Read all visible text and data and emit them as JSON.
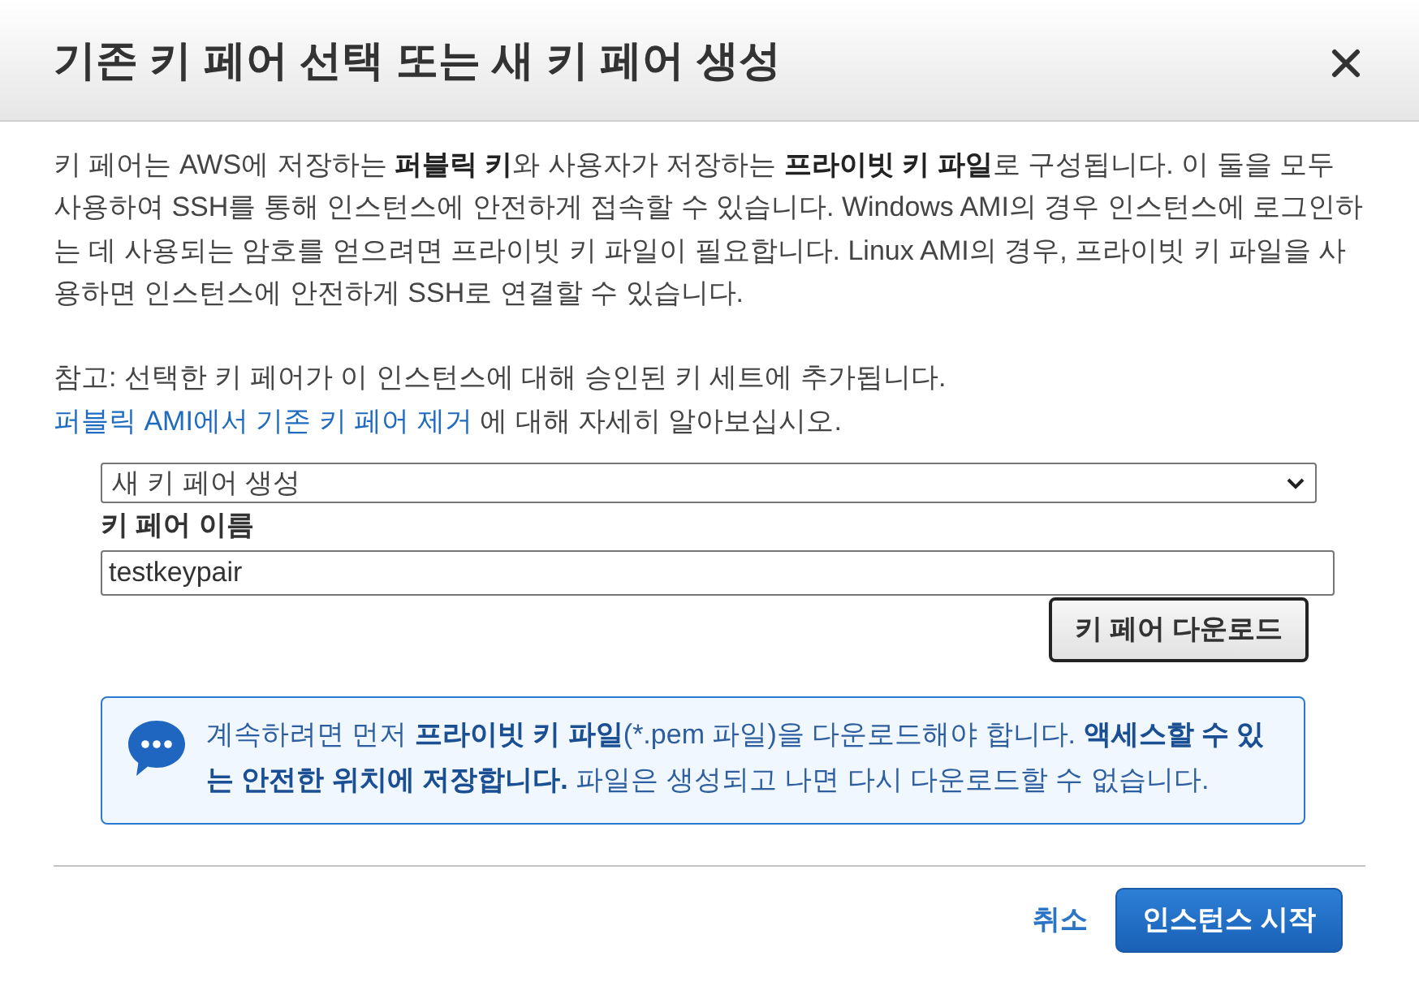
{
  "dialog": {
    "title": "기존 키 페어 선택 또는 새 키 페어 생성"
  },
  "description": "키 페어는 AWS에 저장하는 **퍼블릭 키**와 사용자가 저장하는 **프라이빗 키 파일**로 구성됩니다. 이 둘을 모두 사용하여 SSH를 통해 인스턴스에 안전하게 접속할 수 있습니다. Windows AMI의 경우 인스턴스에 로그인하는 데 사용되는 암호를 얻으려면 프라이빗 키 파일이 필요합니다. Linux AMI의 경우, 프라이빗 키 파일을 사용하면 인스턴스에 안전하게 SSH로 연결할 수 있습니다.",
  "note": {
    "text": "참고: 선택한 키 페어가 이 인스턴스에 대해 승인된 키 세트에 추가됩니다.",
    "link": "퍼블릭 AMI에서 기존 키 페어 제거",
    "suffix": "에 대해 자세히 알아보십시오."
  },
  "key_pair_select": {
    "value": "새 키 페어 생성"
  },
  "key_pair_name": {
    "label": "키 페어 이름",
    "value": "testkeypair"
  },
  "download_button": "키 페어 다운로드",
  "info": [
    {
      "text": "계속하려면 먼저 ",
      "bold": false
    },
    {
      "text": "프라이빗 키 파일",
      "bold": true
    },
    {
      "text": "(*.pem 파일)을 다운로드해야 합니다. ",
      "bold": false
    },
    {
      "text": "액세스할 수 있는 안전한 위치에 저장합니다.",
      "bold": true
    },
    {
      "text": " 파일은 생성되고 나면 다시 다운로드할 수 없습니다.",
      "bold": false
    }
  ],
  "footer": {
    "cancel": "취소",
    "launch": "인스턴스 시작"
  }
}
